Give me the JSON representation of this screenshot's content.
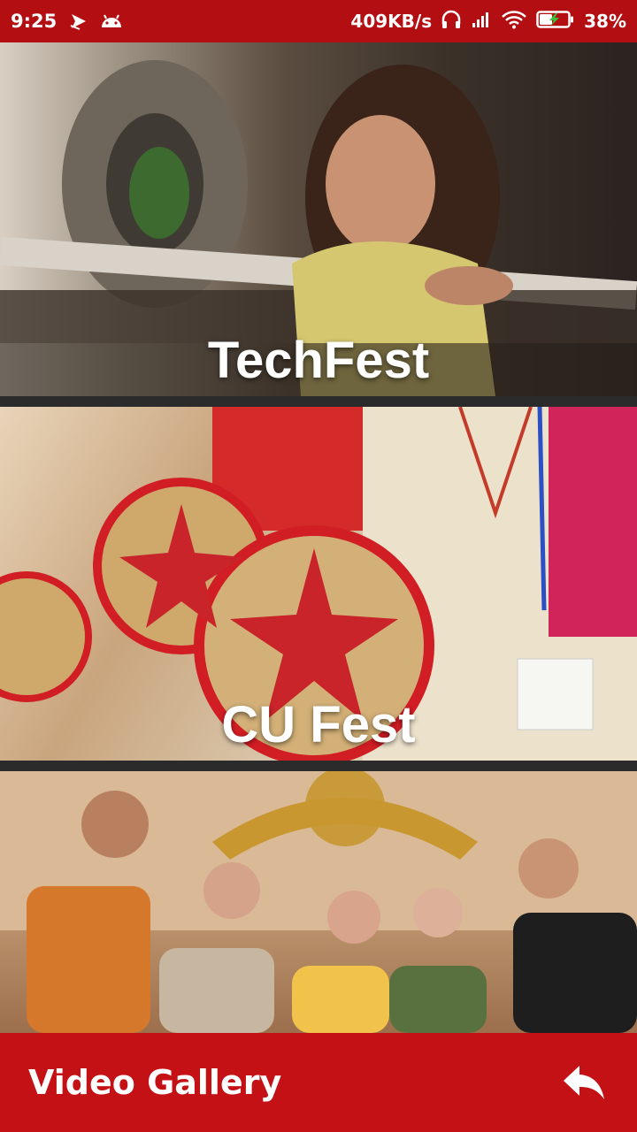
{
  "status_bar": {
    "time": "9:25",
    "network_speed": "409KB/s",
    "battery_percent": "38%",
    "left_icons": [
      "navigation-arrow-icon",
      "android-icon"
    ],
    "right_icons": [
      "headphones-icon",
      "cell-signal-icon",
      "wifi-icon",
      "battery-charging-icon"
    ]
  },
  "cards": [
    {
      "title": "TechFest",
      "image": "student-soldering-electronics"
    },
    {
      "title": "CU Fest",
      "image": "women-holding-japi-hats"
    },
    {
      "title": "",
      "image": "students-thumbs-up-group"
    }
  ],
  "bottom_bar": {
    "title": "Video Gallery",
    "icon": "reply-back-icon"
  },
  "colors": {
    "status_bar": "#b30f12",
    "bottom_bar": "#c41115",
    "divider": "#2b2b2b"
  }
}
